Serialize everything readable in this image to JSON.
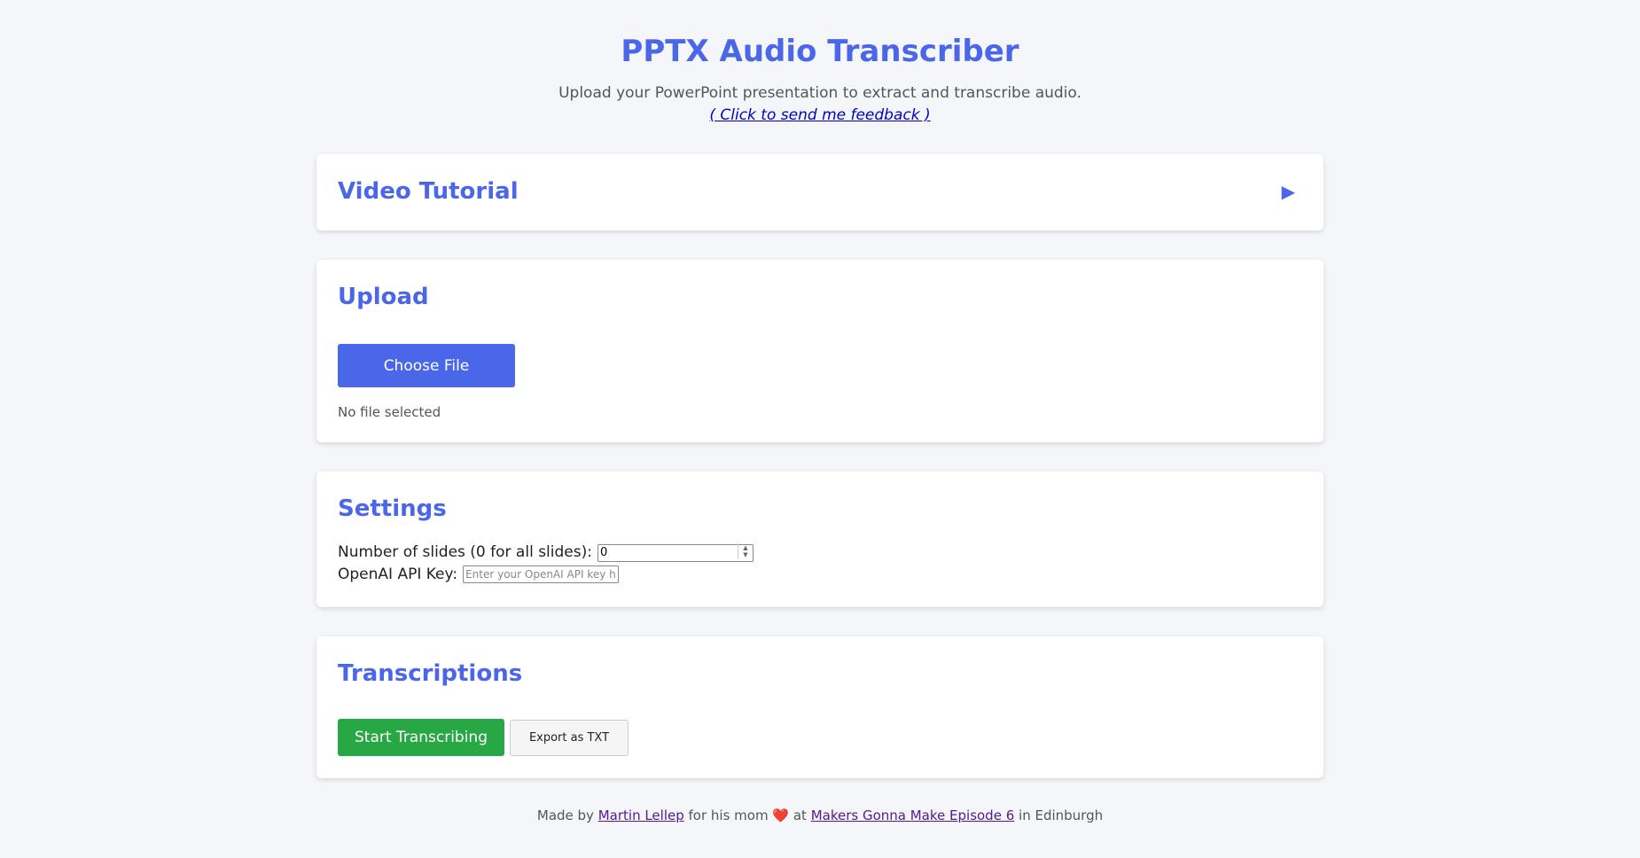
{
  "header": {
    "title": "PPTX Audio Transcriber",
    "subtitle": "Upload your PowerPoint presentation to extract and transcribe audio.",
    "feedback_link": "( Click to send me feedback )"
  },
  "tutorial": {
    "heading": "Video Tutorial",
    "toggle_icon": "▶"
  },
  "upload": {
    "heading": "Upload",
    "choose_label": "Choose File",
    "status": "No file selected"
  },
  "settings": {
    "heading": "Settings",
    "slides_label": "Number of slides (0 for all slides):",
    "slides_value": "0",
    "api_label": "OpenAI API Key:",
    "api_placeholder": "Enter your OpenAI API key here"
  },
  "transcriptions": {
    "heading": "Transcriptions",
    "start_label": "Start Transcribing",
    "export_label": "Export as TXT"
  },
  "footer": {
    "made_by": "Made by",
    "author": "Martin Lellep",
    "for_text": "for his mom",
    "heart": "❤️",
    "at": "at",
    "event": "Makers Gonna Make Episode 6",
    "location": "in Edinburgh"
  },
  "colors": {
    "accent": "#4a67ea",
    "start_button": "#28a745",
    "background": "#f4f6fa"
  }
}
